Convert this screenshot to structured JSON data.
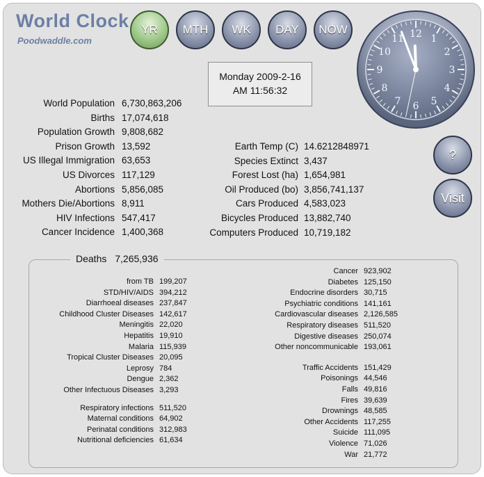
{
  "brand": {
    "title": "World Clock",
    "subtitle": "Poodwaddle.com"
  },
  "nav": [
    "YR",
    "MTH",
    "WK",
    "DAY",
    "NOW"
  ],
  "side_buttons": {
    "help": "?",
    "visit": "Visit"
  },
  "datetime": {
    "date": "Monday 2009-2-16",
    "time": "AM 11:56:32"
  },
  "clock": {
    "hour": 11,
    "minute": 56,
    "second": 32
  },
  "left_stats": [
    {
      "label": "World Population",
      "value": "6,730,863,206"
    },
    {
      "label": "Births",
      "value": "17,074,618"
    },
    {
      "label": "Population Growth",
      "value": "9,808,682"
    },
    {
      "label": "Prison Growth",
      "value": "13,592"
    },
    {
      "label": "US Illegal Immigration",
      "value": "63,653"
    },
    {
      "label": "US Divorces",
      "value": "117,129"
    },
    {
      "label": "Abortions",
      "value": "5,856,085"
    },
    {
      "label": "Mothers Die/Abortions",
      "value": "8,911"
    },
    {
      "label": "HIV Infections",
      "value": "547,417"
    },
    {
      "label": "Cancer Incidence",
      "value": "1,400,368"
    }
  ],
  "right_stats": [
    {
      "label": "Earth Temp (C)",
      "value": "14.6212848971"
    },
    {
      "label": "Species Extinct",
      "value": "3,437"
    },
    {
      "label": "Forest Lost (ha)",
      "value": "1,654,981"
    },
    {
      "label": "Oil Produced (bo)",
      "value": "3,856,741,137"
    },
    {
      "label": "Cars Produced",
      "value": "4,583,023"
    },
    {
      "label": "Bicycles Produced",
      "value": "13,882,740"
    },
    {
      "label": "Computers Produced",
      "value": "10,719,182"
    }
  ],
  "deaths": {
    "label": "Deaths",
    "value": "7,265,936",
    "left_groups": [
      [
        {
          "label": "from TB",
          "value": "199,207"
        },
        {
          "label": "STD/HIV/AIDS",
          "value": "394,212"
        },
        {
          "label": "Diarrhoeal diseases",
          "value": "237,847"
        },
        {
          "label": "Childhood Cluster Diseases",
          "value": "142,617"
        },
        {
          "label": "Meningitis",
          "value": "22,020"
        },
        {
          "label": "Hepatitis",
          "value": "19,910"
        },
        {
          "label": "Malaria",
          "value": "115,939"
        },
        {
          "label": "Tropical Cluster Diseases",
          "value": "20,095"
        },
        {
          "label": "Leprosy",
          "value": "784"
        },
        {
          "label": "Dengue",
          "value": "2,362"
        },
        {
          "label": "Other Infectuous Diseases",
          "value": "3,293"
        }
      ],
      [
        {
          "label": "Respiratory infections",
          "value": "511,520"
        },
        {
          "label": "Maternal conditions",
          "value": "64,902"
        },
        {
          "label": "Perinatal conditions",
          "value": "312,983"
        },
        {
          "label": "Nutritional deficiencies",
          "value": "61,634"
        }
      ]
    ],
    "right_groups": [
      [
        {
          "label": "Cancer",
          "value": "923,902"
        },
        {
          "label": "Diabetes",
          "value": "125,150"
        },
        {
          "label": "Endocrine disorders",
          "value": "30,715"
        },
        {
          "label": "Psychiatric conditions",
          "value": "141,161"
        },
        {
          "label": "Cardiovascular diseases",
          "value": "2,126,585"
        },
        {
          "label": "Respiratory diseases",
          "value": "511,520"
        },
        {
          "label": "Digestive diseases",
          "value": "250,074"
        },
        {
          "label": "Other noncommunicable",
          "value": "193,061"
        }
      ],
      [
        {
          "label": "Traffic Accidents",
          "value": "151,429"
        },
        {
          "label": "Poisonings",
          "value": "44,546"
        },
        {
          "label": "Falls",
          "value": "49,816"
        },
        {
          "label": "Fires",
          "value": "39,639"
        },
        {
          "label": "Drownings",
          "value": "48,585"
        },
        {
          "label": "Other Accidents",
          "value": "117,255"
        },
        {
          "label": "Suicide",
          "value": "111,095"
        },
        {
          "label": "Violence",
          "value": "71,026"
        },
        {
          "label": "War",
          "value": "21,772"
        }
      ]
    ]
  }
}
